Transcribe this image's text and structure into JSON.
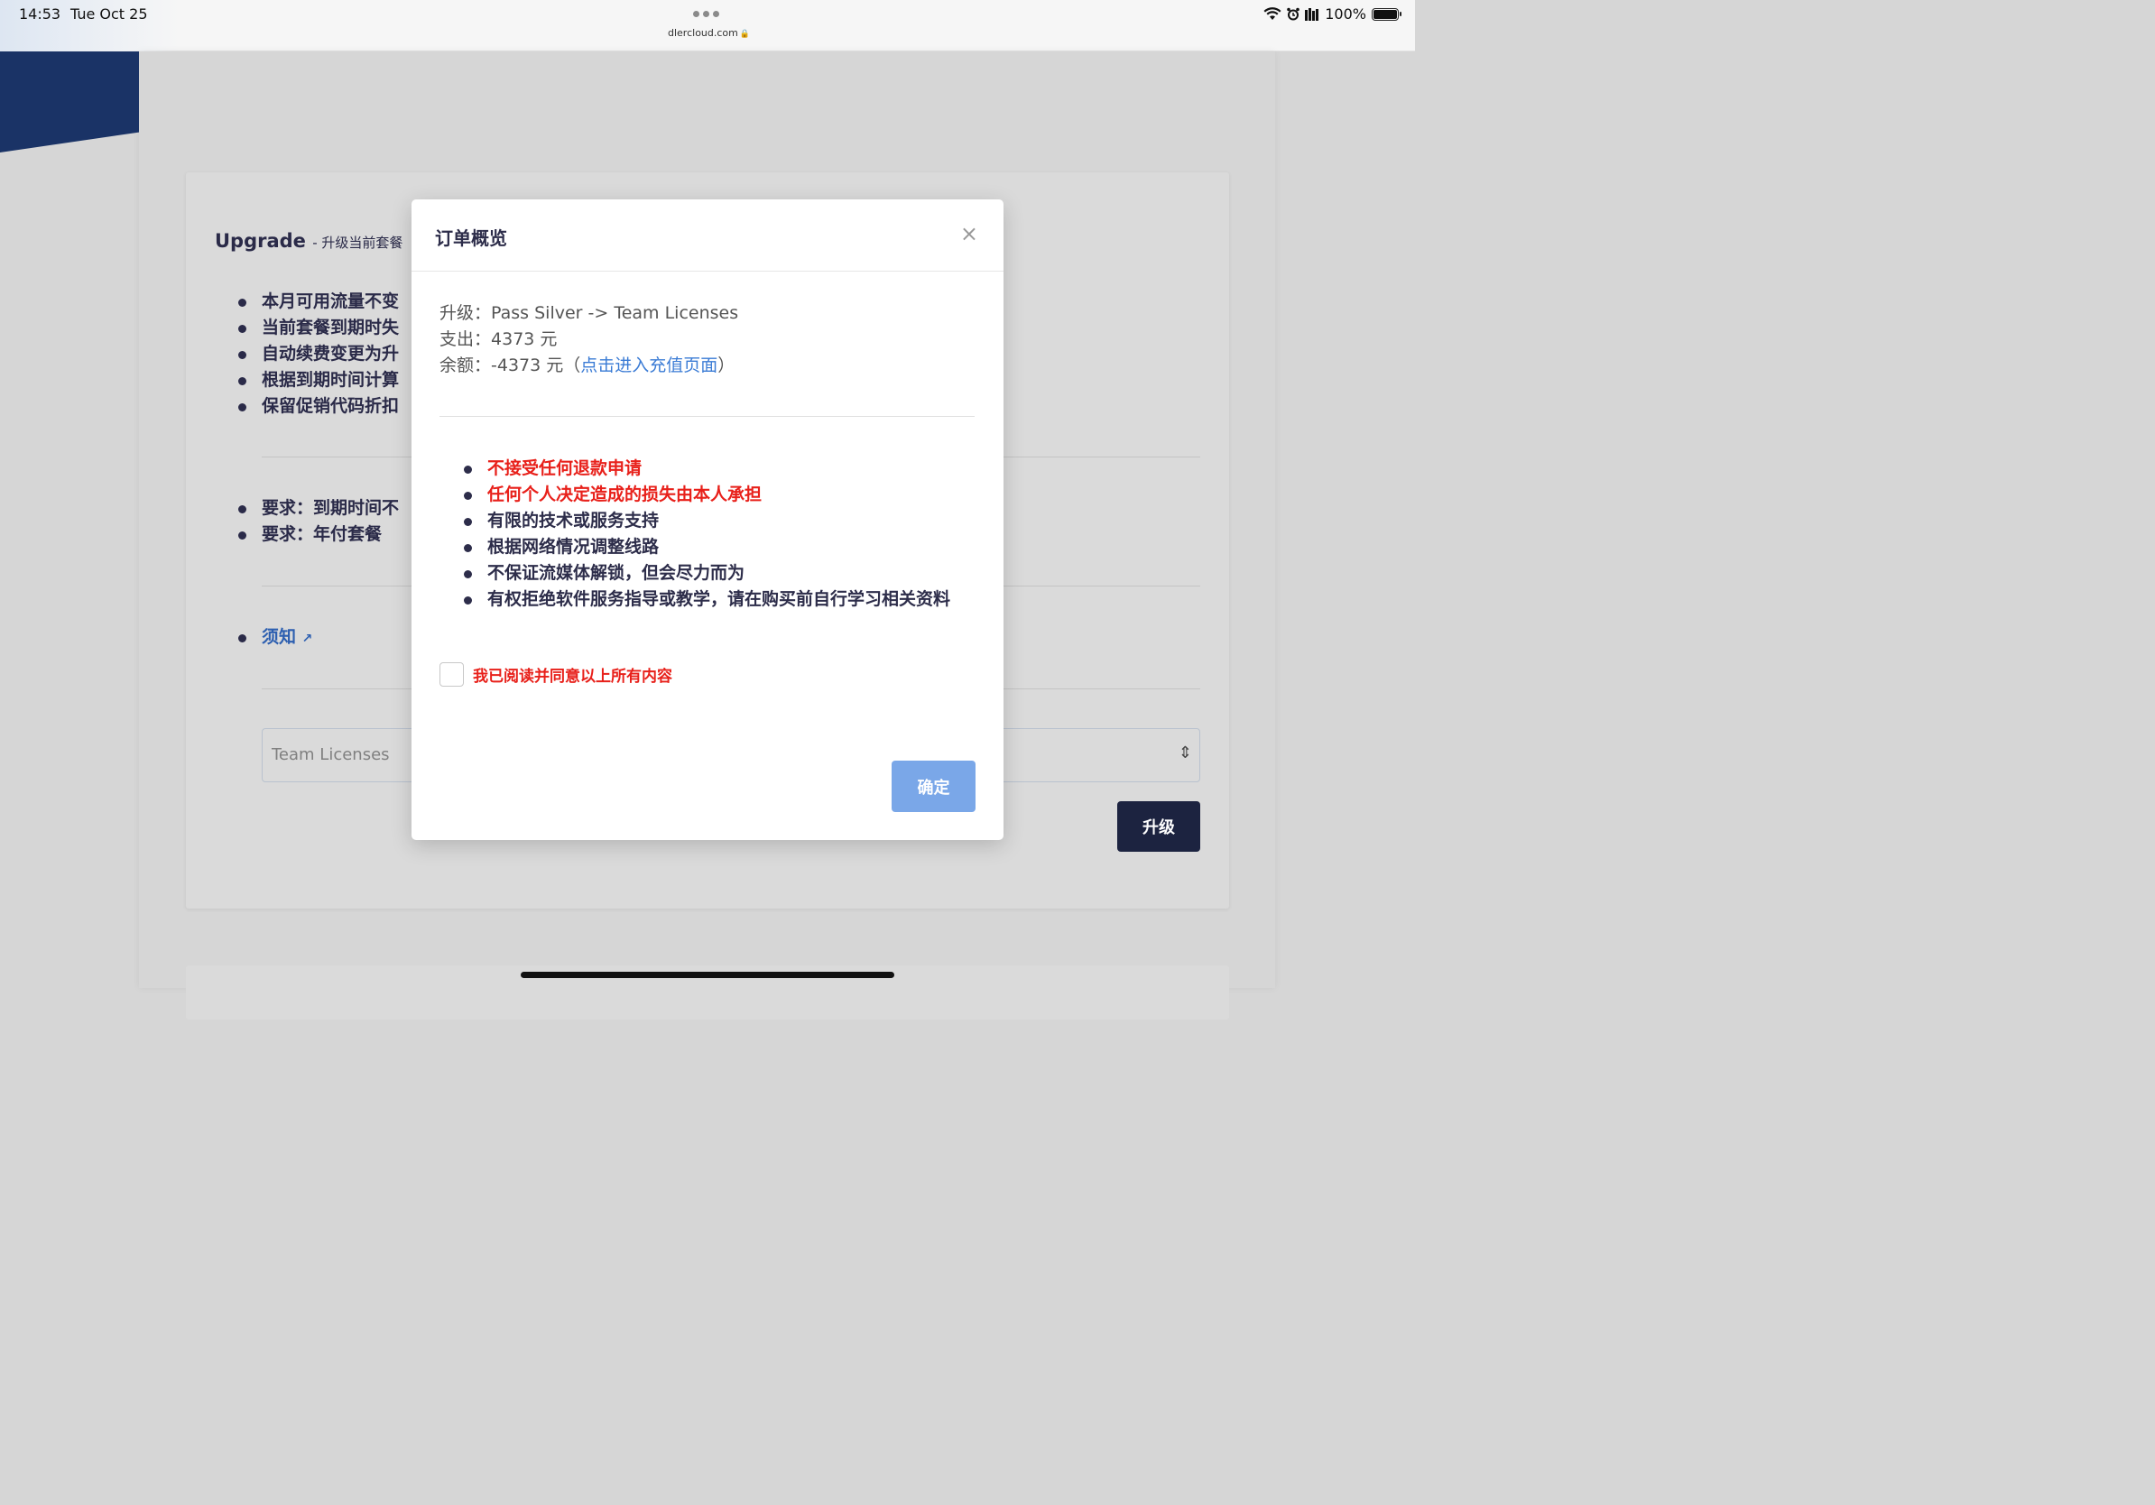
{
  "status_bar": {
    "time": "14:53",
    "date": "Tue Oct 25",
    "url": "dlercloud.com",
    "battery": "100%"
  },
  "background_page": {
    "title": "Upgrade",
    "subtitle": "- 升级当前套餐",
    "bullets": [
      "本月可用流量不变",
      "当前套餐到期时失",
      "自动续费变更为升",
      "根据到期时间计算",
      "保留促销代码折扣"
    ],
    "requirements": [
      "要求：到期时间不",
      "要求：年付套餐"
    ],
    "notice_link": "须知",
    "plan_select_value": "Team Licenses",
    "upgrade_button": "升级"
  },
  "modal": {
    "title": "订单概览",
    "close": "×",
    "upgrade_label": "升级：",
    "upgrade_value": "Pass Silver -> Team Licenses",
    "cost_label": "支出：",
    "cost_value": "4373 元",
    "balance_label": "余额：",
    "balance_value": "-4373 元",
    "recharge_open": "（",
    "recharge_link": "点击进入充值页面",
    "recharge_close": "）",
    "notes": [
      {
        "text": "不接受任何退款申请",
        "warn": true
      },
      {
        "text": "任何个人决定造成的损失由本人承担",
        "warn": true
      },
      {
        "text": "有限的技术或服务支持",
        "warn": false
      },
      {
        "text": "根据网络情况调整线路",
        "warn": false
      },
      {
        "text": "不保证流媒体解锁，但会尽力而为",
        "warn": false
      },
      {
        "text": "有权拒绝软件服务指导或教学，请在购买前自行学习相关资料",
        "warn": false
      }
    ],
    "agree_label": "我已阅读并同意以上所有内容",
    "agree_checked": false,
    "confirm_button": "确定"
  }
}
